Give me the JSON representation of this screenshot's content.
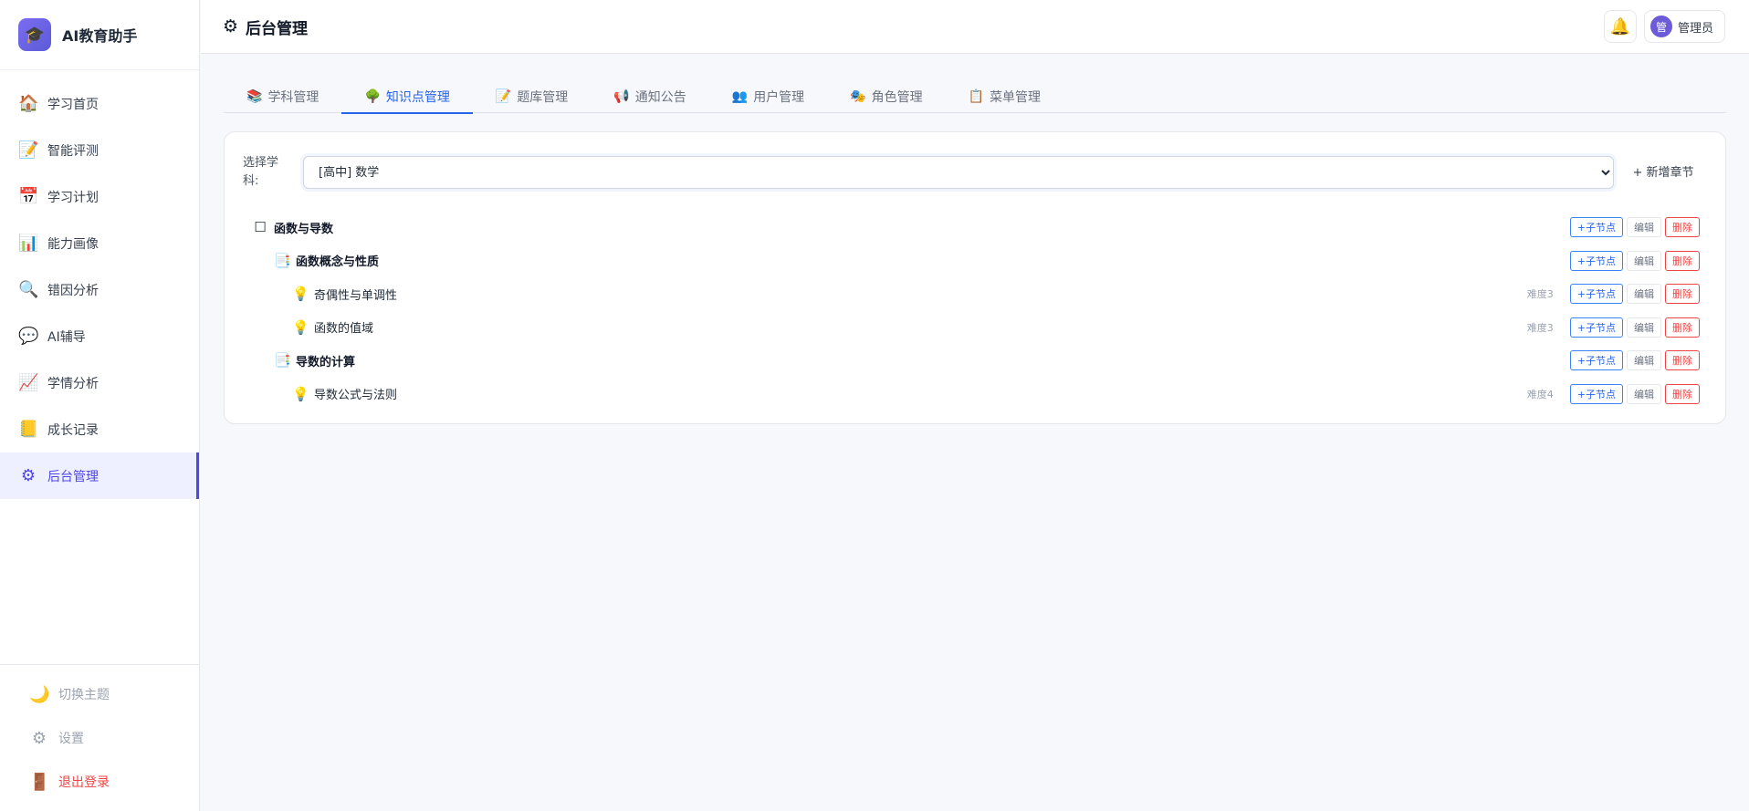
{
  "brand": {
    "title": "AI教育助手",
    "logo_icon": "graduation-cap-icon"
  },
  "sidebar": {
    "items": [
      {
        "label": "学习首页",
        "icon": "🏠"
      },
      {
        "label": "智能评测",
        "icon": "📝"
      },
      {
        "label": "学习计划",
        "icon": "📅"
      },
      {
        "label": "能力画像",
        "icon": "📊"
      },
      {
        "label": "错因分析",
        "icon": "🔍"
      },
      {
        "label": "AI辅导",
        "icon": "💬"
      },
      {
        "label": "学情分析",
        "icon": "📈"
      },
      {
        "label": "成长记录",
        "icon": "📒"
      },
      {
        "label": "后台管理",
        "icon": "⚙"
      }
    ],
    "active_index": 8,
    "bottom": [
      {
        "label": "切换主题",
        "icon": "🌙"
      },
      {
        "label": "设置",
        "icon": "⚙"
      },
      {
        "label": "退出登录",
        "icon": "🚪"
      }
    ]
  },
  "header": {
    "title": "后台管理",
    "title_icon": "⚙",
    "bell_icon": "🔔",
    "user": {
      "avatar_text": "管",
      "name": "管理员"
    }
  },
  "tabs": [
    {
      "label": "学科管理",
      "icon": "📚"
    },
    {
      "label": "知识点管理",
      "icon": "🌳"
    },
    {
      "label": "题库管理",
      "icon": "📝"
    },
    {
      "label": "通知公告",
      "icon": "📢"
    },
    {
      "label": "用户管理",
      "icon": "👥"
    },
    {
      "label": "角色管理",
      "icon": "🎭"
    },
    {
      "label": "菜单管理",
      "icon": "📋"
    }
  ],
  "active_tab": 1,
  "subject": {
    "label": "选择学科:",
    "selected": "[高中] 数学",
    "add_chapter_label": "+ 新增章节"
  },
  "actions": {
    "add_child": "+子节点",
    "edit": "编辑",
    "delete": "删除"
  },
  "tree": [
    {
      "level": 0,
      "label": "函数与导数",
      "icon": "☐",
      "difficulty": ""
    },
    {
      "level": 1,
      "label": "函数概念与性质",
      "icon": "📑",
      "difficulty": ""
    },
    {
      "level": 2,
      "label": "奇偶性与单调性",
      "icon": "💡",
      "difficulty": "难度3"
    },
    {
      "level": 2,
      "label": "函数的值域",
      "icon": "💡",
      "difficulty": "难度3"
    },
    {
      "level": 1,
      "label": "导数的计算",
      "icon": "📑",
      "difficulty": ""
    },
    {
      "level": 2,
      "label": "导数公式与法则",
      "icon": "💡",
      "difficulty": "难度4"
    }
  ]
}
